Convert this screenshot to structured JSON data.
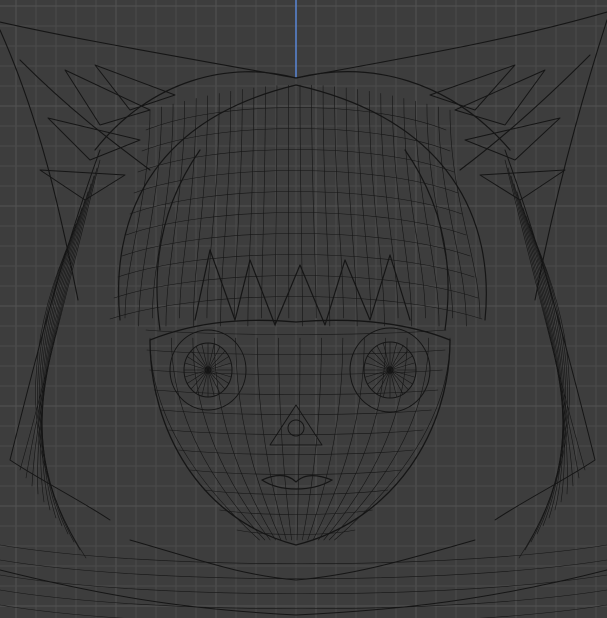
{
  "viewport": {
    "background_color": "#3d3d3d",
    "grid_color": "#4a4a4a",
    "grid_major_color": "#525252",
    "z_axis_color": "#5a86d6",
    "wire_color": "#151515",
    "view_mode": "wireframe",
    "object": "anime-character-head-mesh"
  }
}
